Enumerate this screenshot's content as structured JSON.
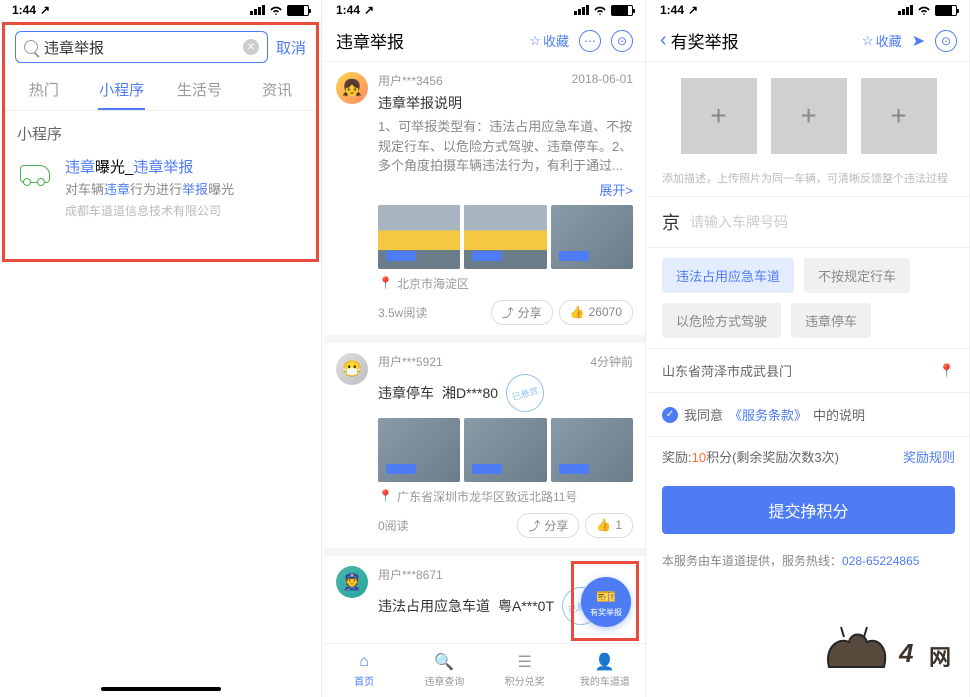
{
  "status": {
    "time": "1:44",
    "arrow": "↗"
  },
  "screen1": {
    "search": {
      "value": "违章举报",
      "cancel": "取消"
    },
    "tabs": [
      "热门",
      "小程序",
      "生活号",
      "资讯"
    ],
    "active_tab": 1,
    "section_title": "小程序",
    "item": {
      "title_p1": "违章",
      "title_p2": "曝光_",
      "title_p3": "违章举报",
      "desc_p1": "对车辆",
      "desc_p2": "违章",
      "desc_p3": "行为进行",
      "desc_p4": "举报",
      "desc_p5": "曝光",
      "meta": "成都车道道信息技术有限公司"
    }
  },
  "screen2": {
    "title": "违章举报",
    "fav": "收藏",
    "posts": [
      {
        "user": "用户***3456",
        "time": "2018-06-01",
        "title": "违章举报说明",
        "desc": "1、可举报类型有：违法占用应急车道、不按规定行车、以危险方式驾驶、违章停车。2、多个角度拍摄车辆违法行为，有利于通过...",
        "expand": "展开>",
        "loc": "北京市海淀区",
        "reads": "3.5w阅读",
        "share": "分享",
        "like": "26070"
      },
      {
        "user": "用户***5921",
        "time": "4分钟前",
        "title": "违章停车",
        "plate": "湘D***80",
        "stamp": "已悬赏",
        "loc": "广东省深圳市龙华区致远北路11号",
        "reads": "0阅读",
        "share": "分享",
        "like": "1"
      },
      {
        "user": "用户***8671",
        "title": "违法占用应急车道",
        "plate": "粤A***0T",
        "stamp": "已悬赏"
      }
    ],
    "fab": "有奖举报",
    "nav": [
      "首页",
      "违章查询",
      "积分兑奖",
      "我的车道道"
    ]
  },
  "screen3": {
    "title": "有奖举报",
    "fav": "收藏",
    "hint": "添加描述，上传照片为同一车辆，可清晰反馈整个违法过程",
    "plate_prefix": "京",
    "plate_placeholder": "请输入车牌号码",
    "tags": [
      "违法占用应急车道",
      "不按规定行车",
      "以危险方式驾驶",
      "违章停车"
    ],
    "active_tag": 0,
    "location": "山东省菏泽市成武县门",
    "agree_p1": "我同意",
    "agree_link": "《服务条款》",
    "agree_p2": "中的说明",
    "reward_p1": "奖励:",
    "reward_num": "10",
    "reward_p2": "积分(剩余奖励次数3次)",
    "reward_rule": "奖励规则",
    "submit": "提交挣积分",
    "service_p1": "本服务由车道道提供，服务热线：",
    "service_phone": "028-65224865"
  }
}
